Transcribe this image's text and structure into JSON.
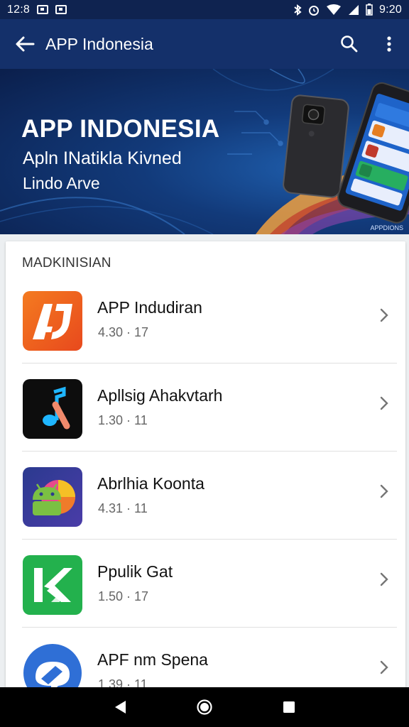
{
  "status_bar": {
    "time_left": "12:8",
    "time_right": "9:20"
  },
  "app_bar": {
    "title": "APP Indonesia"
  },
  "hero": {
    "title": "APP INDONESIA",
    "subtitle_1": "Apln INatikla Kivned",
    "subtitle_2": "Lindo Arve",
    "watermark": "APPDIONS"
  },
  "section": {
    "title": "MADKINISIAN"
  },
  "apps": [
    {
      "name": "APP Indudiran",
      "meta": "4.30 · 17",
      "icon": "orange-aj-icon"
    },
    {
      "name": "Apllsig Ahakvtarh",
      "meta": "1.30 · 11",
      "icon": "music-note-icon"
    },
    {
      "name": "Abrlhia Koonta",
      "meta": "4.31 · 11",
      "icon": "android-icon"
    },
    {
      "name": "Ppulik Gat",
      "meta": "1.50 · 17",
      "icon": "green-k-icon"
    },
    {
      "name": "APF nm Spena",
      "meta": "1.39 · 11",
      "icon": "blue-chat-icon"
    }
  ],
  "colors": {
    "status_bar": "#0f2350",
    "app_bar": "#14306a",
    "hero": "#123a7a",
    "nav_bar": "#000000"
  }
}
